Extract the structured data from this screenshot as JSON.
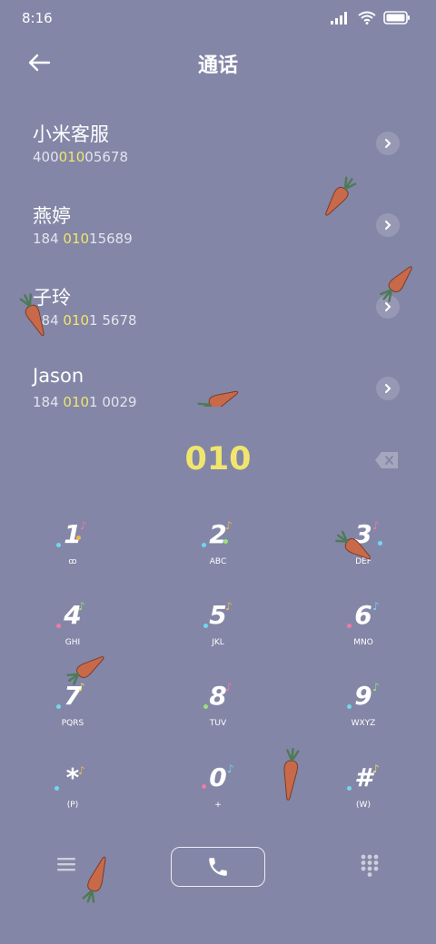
{
  "status_bar": {
    "time": "8:16",
    "icons": [
      "signal-icon",
      "wifi-icon",
      "battery-icon"
    ]
  },
  "header": {
    "title": "通话",
    "back_icon": "back-arrow-icon"
  },
  "contacts": [
    {
      "name": "小米客服",
      "number_pre": "400",
      "number_hl": "010",
      "number_post": "05678"
    },
    {
      "name": "燕婷",
      "number_pre": "184 ",
      "number_hl": "010",
      "number_post": "15689"
    },
    {
      "name": "子玲",
      "number_pre": "184 ",
      "number_hl": "010",
      "number_post": "1 5678"
    },
    {
      "name": "Jason",
      "number_pre": "184 ",
      "number_hl": "010",
      "number_post": "1 0029"
    }
  ],
  "dial_input": {
    "value": "010",
    "delete_icon": "backspace-icon"
  },
  "keypad": [
    {
      "digit": "1",
      "letters": "ꝏ"
    },
    {
      "digit": "2",
      "letters": "ABC"
    },
    {
      "digit": "3",
      "letters": "DEF"
    },
    {
      "digit": "4",
      "letters": "GHI"
    },
    {
      "digit": "5",
      "letters": "JKL"
    },
    {
      "digit": "6",
      "letters": "MNO"
    },
    {
      "digit": "7",
      "letters": "PQRS"
    },
    {
      "digit": "8",
      "letters": "TUV"
    },
    {
      "digit": "9",
      "letters": "WXYZ"
    },
    {
      "digit": "*",
      "letters": "(P)"
    },
    {
      "digit": "0",
      "letters": "+"
    },
    {
      "digit": "#",
      "letters": "(W)"
    }
  ],
  "bottom_bar": {
    "menu_icon": "menu-icon",
    "call_icon": "phone-icon",
    "keypad_icon": "dialpad-icon"
  },
  "colors": {
    "background": "#8386a6",
    "highlight": "#f1e66d",
    "carrot": "#c86a4a",
    "leaf": "#4d7a55"
  }
}
